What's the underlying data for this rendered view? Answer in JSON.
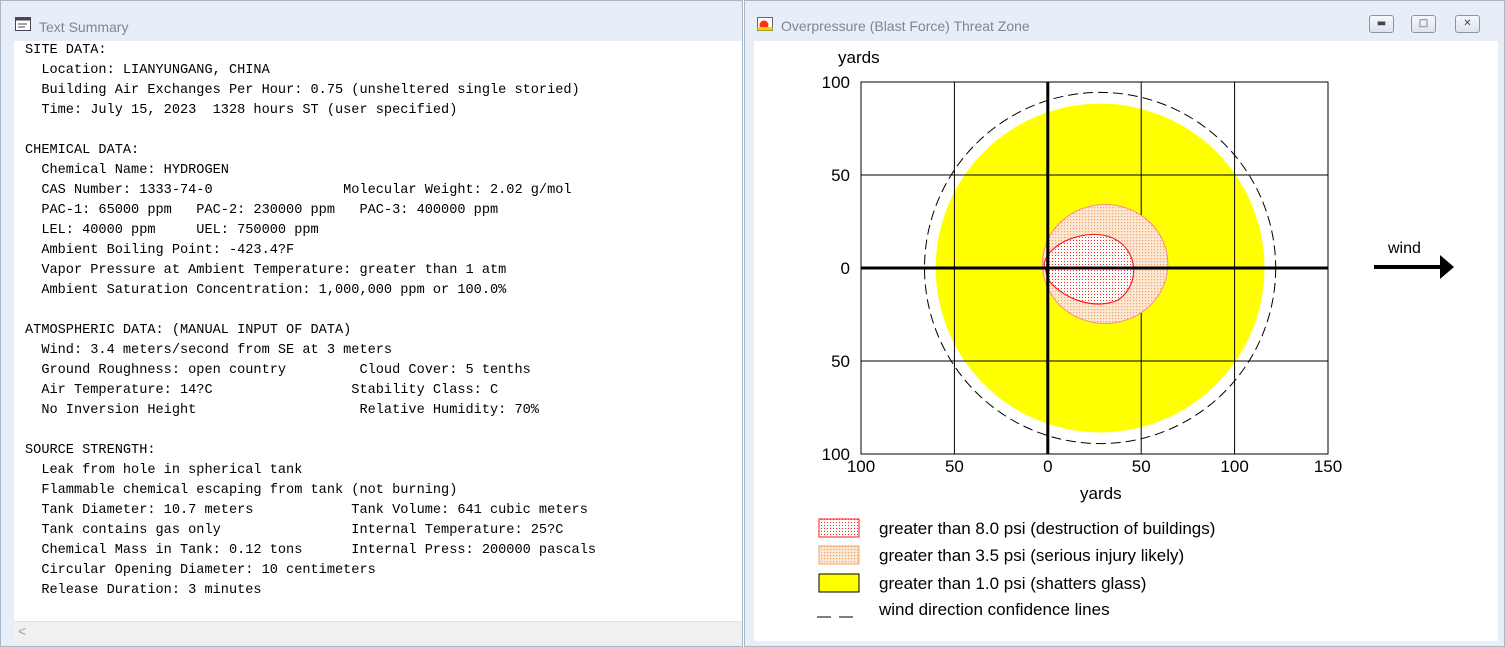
{
  "left_window": {
    "title": "Text Summary",
    "icon": "text-window-icon",
    "lines": [
      "SITE DATA:",
      "  Location: LIANYUNGANG, CHINA",
      "  Building Air Exchanges Per Hour: 0.75 (unsheltered single storied)",
      "  Time: July 15, 2023  1328 hours ST (user specified)",
      "",
      "CHEMICAL DATA:",
      "  Chemical Name: HYDROGEN",
      "  CAS Number: 1333-74-0                Molecular Weight: 2.02 g/mol",
      "  PAC-1: 65000 ppm   PAC-2: 230000 ppm   PAC-3: 400000 ppm",
      "  LEL: 40000 ppm     UEL: 750000 ppm",
      "  Ambient Boiling Point: -423.4?F",
      "  Vapor Pressure at Ambient Temperature: greater than 1 atm",
      "  Ambient Saturation Concentration: 1,000,000 ppm or 100.0%",
      "",
      "ATMOSPHERIC DATA: (MANUAL INPUT OF DATA)",
      "  Wind: 3.4 meters/second from SE at 3 meters",
      "  Ground Roughness: open country         Cloud Cover: 5 tenths",
      "  Air Temperature: 14?C                 Stability Class: C",
      "  No Inversion Height                    Relative Humidity: 70%",
      "",
      "SOURCE STRENGTH:",
      "  Leak from hole in spherical tank",
      "  Flammable chemical escaping from tank (not burning)",
      "  Tank Diameter: 10.7 meters            Tank Volume: 641 cubic meters",
      "  Tank contains gas only                Internal Temperature: 25?C",
      "  Chemical Mass in Tank: 0.12 tons      Internal Press: 200000 pascals",
      "  Circular Opening Diameter: 10 centimeters",
      "  Release Duration: 3 minutes"
    ],
    "scroll_left_glyph": "<"
  },
  "right_window": {
    "title": "Overpressure (Blast Force) Threat Zone",
    "icon": "threat-zone-app-icon",
    "buttons": {
      "minimize": "minimize-icon",
      "maximize": "maximize-icon",
      "close": "close-icon"
    },
    "wind_label": "wind",
    "legend": [
      {
        "label": "greater than 8.0 psi (destruction of buildings)",
        "color": "#ff2020"
      },
      {
        "label": "greater than 3.5 psi (serious injury likely)",
        "color": "#f4a460"
      },
      {
        "label": "greater than 1.0 psi (shatters glass)",
        "color": "#ffff00"
      },
      {
        "label": "wind direction confidence lines",
        "color": "#000000"
      }
    ]
  },
  "chart_data": {
    "type": "area",
    "xlabel": "yards",
    "ylabel": "yards",
    "xlim": [
      -100,
      150
    ],
    "ylim": [
      -100,
      100
    ],
    "x_ticks": [
      "100",
      "50",
      "0",
      "50",
      "100",
      "150"
    ],
    "y_ticks": [
      "100",
      "50",
      "0",
      "50",
      "100"
    ],
    "grid": true,
    "legend_position": "bottom",
    "series": [
      {
        "name": "greater than 1.0 psi (shatters glass)",
        "shape": "circle",
        "center": [
          28,
          0
        ],
        "radius": 88,
        "color": "#ffff00"
      },
      {
        "name": "greater than 3.5 psi (serious injury likely)",
        "shape": "circle",
        "center": [
          28,
          0
        ],
        "radius": 32,
        "color": "#f4a460"
      },
      {
        "name": "greater than 8.0 psi (destruction of buildings)",
        "shape": "circle",
        "center": [
          28,
          0
        ],
        "radius": 20,
        "color": "#ff2020"
      },
      {
        "name": "wind direction confidence lines",
        "shape": "circle",
        "center": [
          28,
          0
        ],
        "radius": 94,
        "color": "#000000"
      }
    ]
  }
}
